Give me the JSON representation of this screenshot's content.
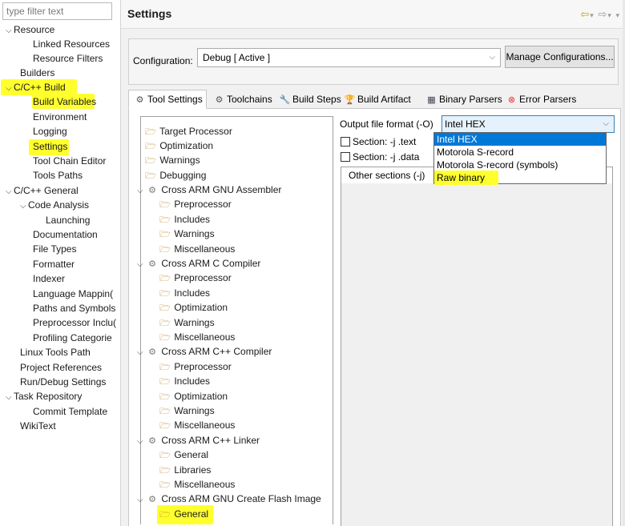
{
  "left_nav": {
    "filter_placeholder": "type filter text",
    "items": [
      {
        "label": "Resource",
        "chevron": "⌵"
      },
      {
        "label": "Linked Resources"
      },
      {
        "label": "Resource Filters"
      },
      {
        "label": "Builders"
      },
      {
        "label": "C/C++ Build",
        "chevron": "⌵"
      },
      {
        "label": "Build Variables"
      },
      {
        "label": "Environment"
      },
      {
        "label": "Logging"
      },
      {
        "label": "Settings"
      },
      {
        "label": "Tool Chain Editor"
      },
      {
        "label": "Tools Paths"
      },
      {
        "label": "C/C++ General",
        "chevron": "⌵"
      },
      {
        "label": "Code Analysis",
        "chevron": "⌵"
      },
      {
        "label": "Launching"
      },
      {
        "label": "Documentation"
      },
      {
        "label": "File Types"
      },
      {
        "label": "Formatter"
      },
      {
        "label": "Indexer"
      },
      {
        "label": "Language Mappin("
      },
      {
        "label": "Paths and Symbols"
      },
      {
        "label": "Preprocessor Inclu("
      },
      {
        "label": "Profiling Categorie"
      },
      {
        "label": "Linux Tools Path"
      },
      {
        "label": "Project References"
      },
      {
        "label": "Run/Debug Settings"
      },
      {
        "label": "Task Repository",
        "chevron": "⌵"
      },
      {
        "label": "Commit Template"
      },
      {
        "label": "WikiText"
      }
    ]
  },
  "header": {
    "title": "Settings",
    "nav_back": "⇦",
    "nav_forward": "⇨",
    "menu_arrow": "▾"
  },
  "configuration": {
    "label": "Configuration:",
    "value": "Debug  [ Active ]",
    "manage_label": "Manage Configurations..."
  },
  "tabs": [
    {
      "label": "Tool Settings",
      "icon": "⚙",
      "active": true
    },
    {
      "label": "Toolchains",
      "icon": "⚙"
    },
    {
      "label": "Build Steps",
      "icon": "🔧"
    },
    {
      "label": "Build Artifact",
      "icon": "🏆"
    },
    {
      "label": "Binary Parsers",
      "icon": "▦"
    },
    {
      "label": "Error Parsers",
      "icon": "⊗"
    }
  ],
  "tree": {
    "nodes": [
      {
        "label": "Target Processor"
      },
      {
        "label": "Optimization"
      },
      {
        "label": "Warnings"
      },
      {
        "label": "Debugging"
      },
      {
        "label": "Cross ARM GNU Assembler"
      },
      {
        "label": "Preprocessor"
      },
      {
        "label": "Includes"
      },
      {
        "label": "Warnings"
      },
      {
        "label": "Miscellaneous"
      },
      {
        "label": "Cross ARM C Compiler"
      },
      {
        "label": "Preprocessor"
      },
      {
        "label": "Includes"
      },
      {
        "label": "Optimization"
      },
      {
        "label": "Warnings"
      },
      {
        "label": "Miscellaneous"
      },
      {
        "label": "Cross ARM C++ Compiler"
      },
      {
        "label": "Preprocessor"
      },
      {
        "label": "Includes"
      },
      {
        "label": "Optimization"
      },
      {
        "label": "Warnings"
      },
      {
        "label": "Miscellaneous"
      },
      {
        "label": "Cross ARM C++ Linker"
      },
      {
        "label": "General"
      },
      {
        "label": "Libraries"
      },
      {
        "label": "Miscellaneous"
      },
      {
        "label": "Cross ARM GNU Create Flash Image"
      },
      {
        "label": "General"
      }
    ]
  },
  "output": {
    "format_label": "Output file format (-O)",
    "format_value": "Intel HEX",
    "section_text": "Section: -j .text",
    "section_data": "Section: -j .data",
    "other_sections_header": "Other sections (-j)",
    "dropdown_options": [
      "Intel HEX",
      "Motorola S-record",
      "Motorola S-record (symbols)",
      "Raw binary"
    ],
    "selected_option": "Intel HEX"
  },
  "colors": {
    "highlight": "#ffff33",
    "selection": "#0078d7"
  }
}
